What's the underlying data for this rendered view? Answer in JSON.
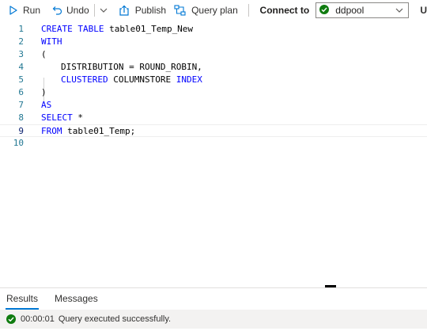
{
  "toolbar": {
    "run_label": "Run",
    "undo_label": "Undo",
    "publish_label": "Publish",
    "query_plan_label": "Query plan",
    "connect_label": "Connect to",
    "connection_value": "ddpool",
    "overflow_label": "U"
  },
  "editor": {
    "lines": [
      {
        "num": "1",
        "tokens": [
          {
            "t": "CREATE TABLE ",
            "kw": true
          },
          {
            "t": "table01_Temp_New",
            "kw": false
          }
        ]
      },
      {
        "num": "2",
        "tokens": [
          {
            "t": "WITH",
            "kw": true
          }
        ]
      },
      {
        "num": "3",
        "tokens": [
          {
            "t": "(",
            "kw": false
          }
        ]
      },
      {
        "num": "4",
        "tokens": [
          {
            "t": "DISTRIBUTION = ROUND_ROBIN,",
            "kw": false
          }
        ]
      },
      {
        "num": "5",
        "tokens": [
          {
            "t": "CLUSTERED ",
            "kw": true
          },
          {
            "t": "COLUMNSTORE ",
            "kw": false
          },
          {
            "t": "INDEX",
            "kw": true
          }
        ]
      },
      {
        "num": "6",
        "tokens": [
          {
            "t": ")",
            "kw": false
          }
        ]
      },
      {
        "num": "7",
        "tokens": [
          {
            "t": "AS",
            "kw": true
          }
        ]
      },
      {
        "num": "8",
        "tokens": [
          {
            "t": "SELECT ",
            "kw": true
          },
          {
            "t": "*",
            "kw": false
          }
        ]
      },
      {
        "num": "9",
        "tokens": [
          {
            "t": "FROM ",
            "kw": true
          },
          {
            "t": "table01_Temp;",
            "kw": false
          }
        ]
      },
      {
        "num": "10",
        "tokens": []
      }
    ]
  },
  "results": {
    "tabs": [
      "Results",
      "Messages"
    ],
    "status_time": "00:00:01",
    "status_message": "Query executed successfully."
  },
  "colors": {
    "accent": "#0078d4",
    "success": "#107c10",
    "keyword": "#0000ff",
    "line_number": "#237893"
  }
}
